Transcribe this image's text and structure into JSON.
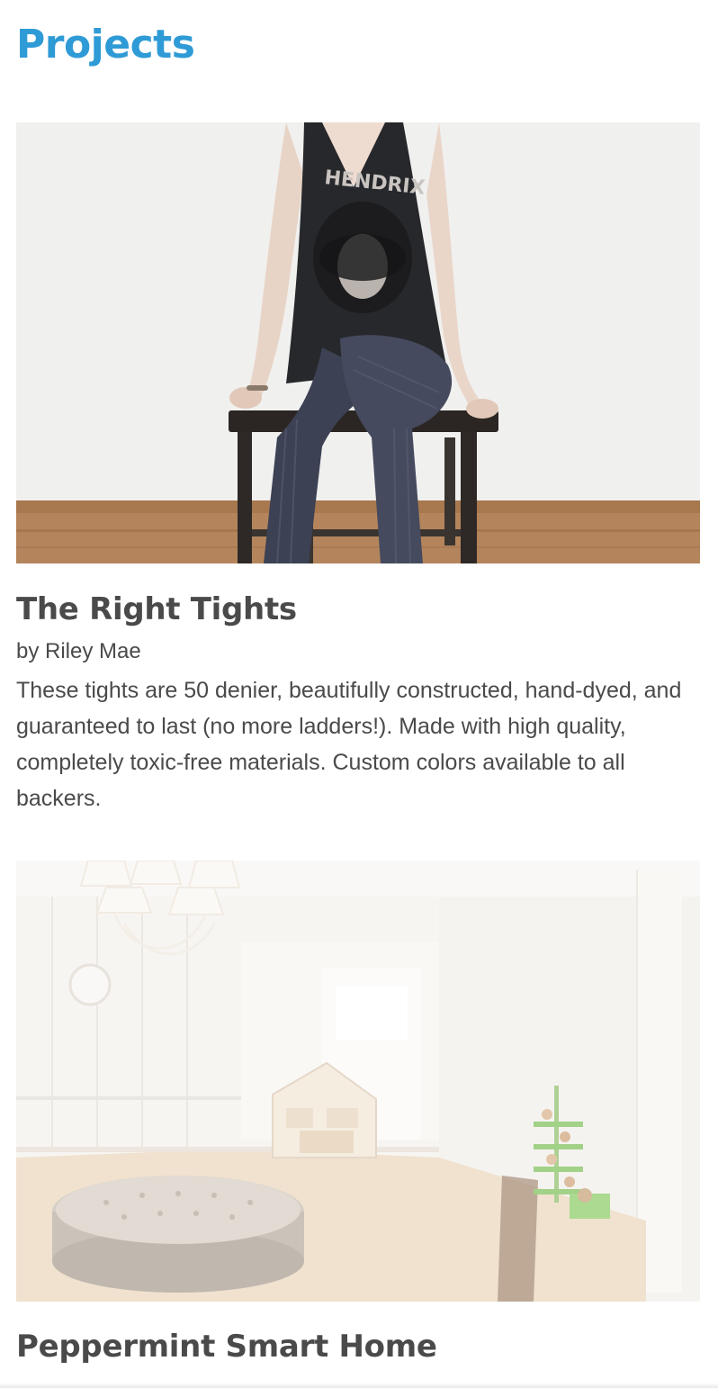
{
  "header": {
    "title": "Projects"
  },
  "projects": [
    {
      "title": "The Right Tights",
      "author": "by Riley Mae",
      "description": "These tights are 50 denier, beautifully constructed, hand-dyed, and guaranteed to last (no more ladders!). Made with high quality, completely toxic-free materials. Custom colors available to all backers.",
      "shirt_text": "HENDRIX"
    },
    {
      "title": "Peppermint Smart Home",
      "author": "",
      "description": ""
    }
  ],
  "colors": {
    "accent": "#2f9bd6",
    "text": "#4a4a4a",
    "background": "#ffffff"
  }
}
